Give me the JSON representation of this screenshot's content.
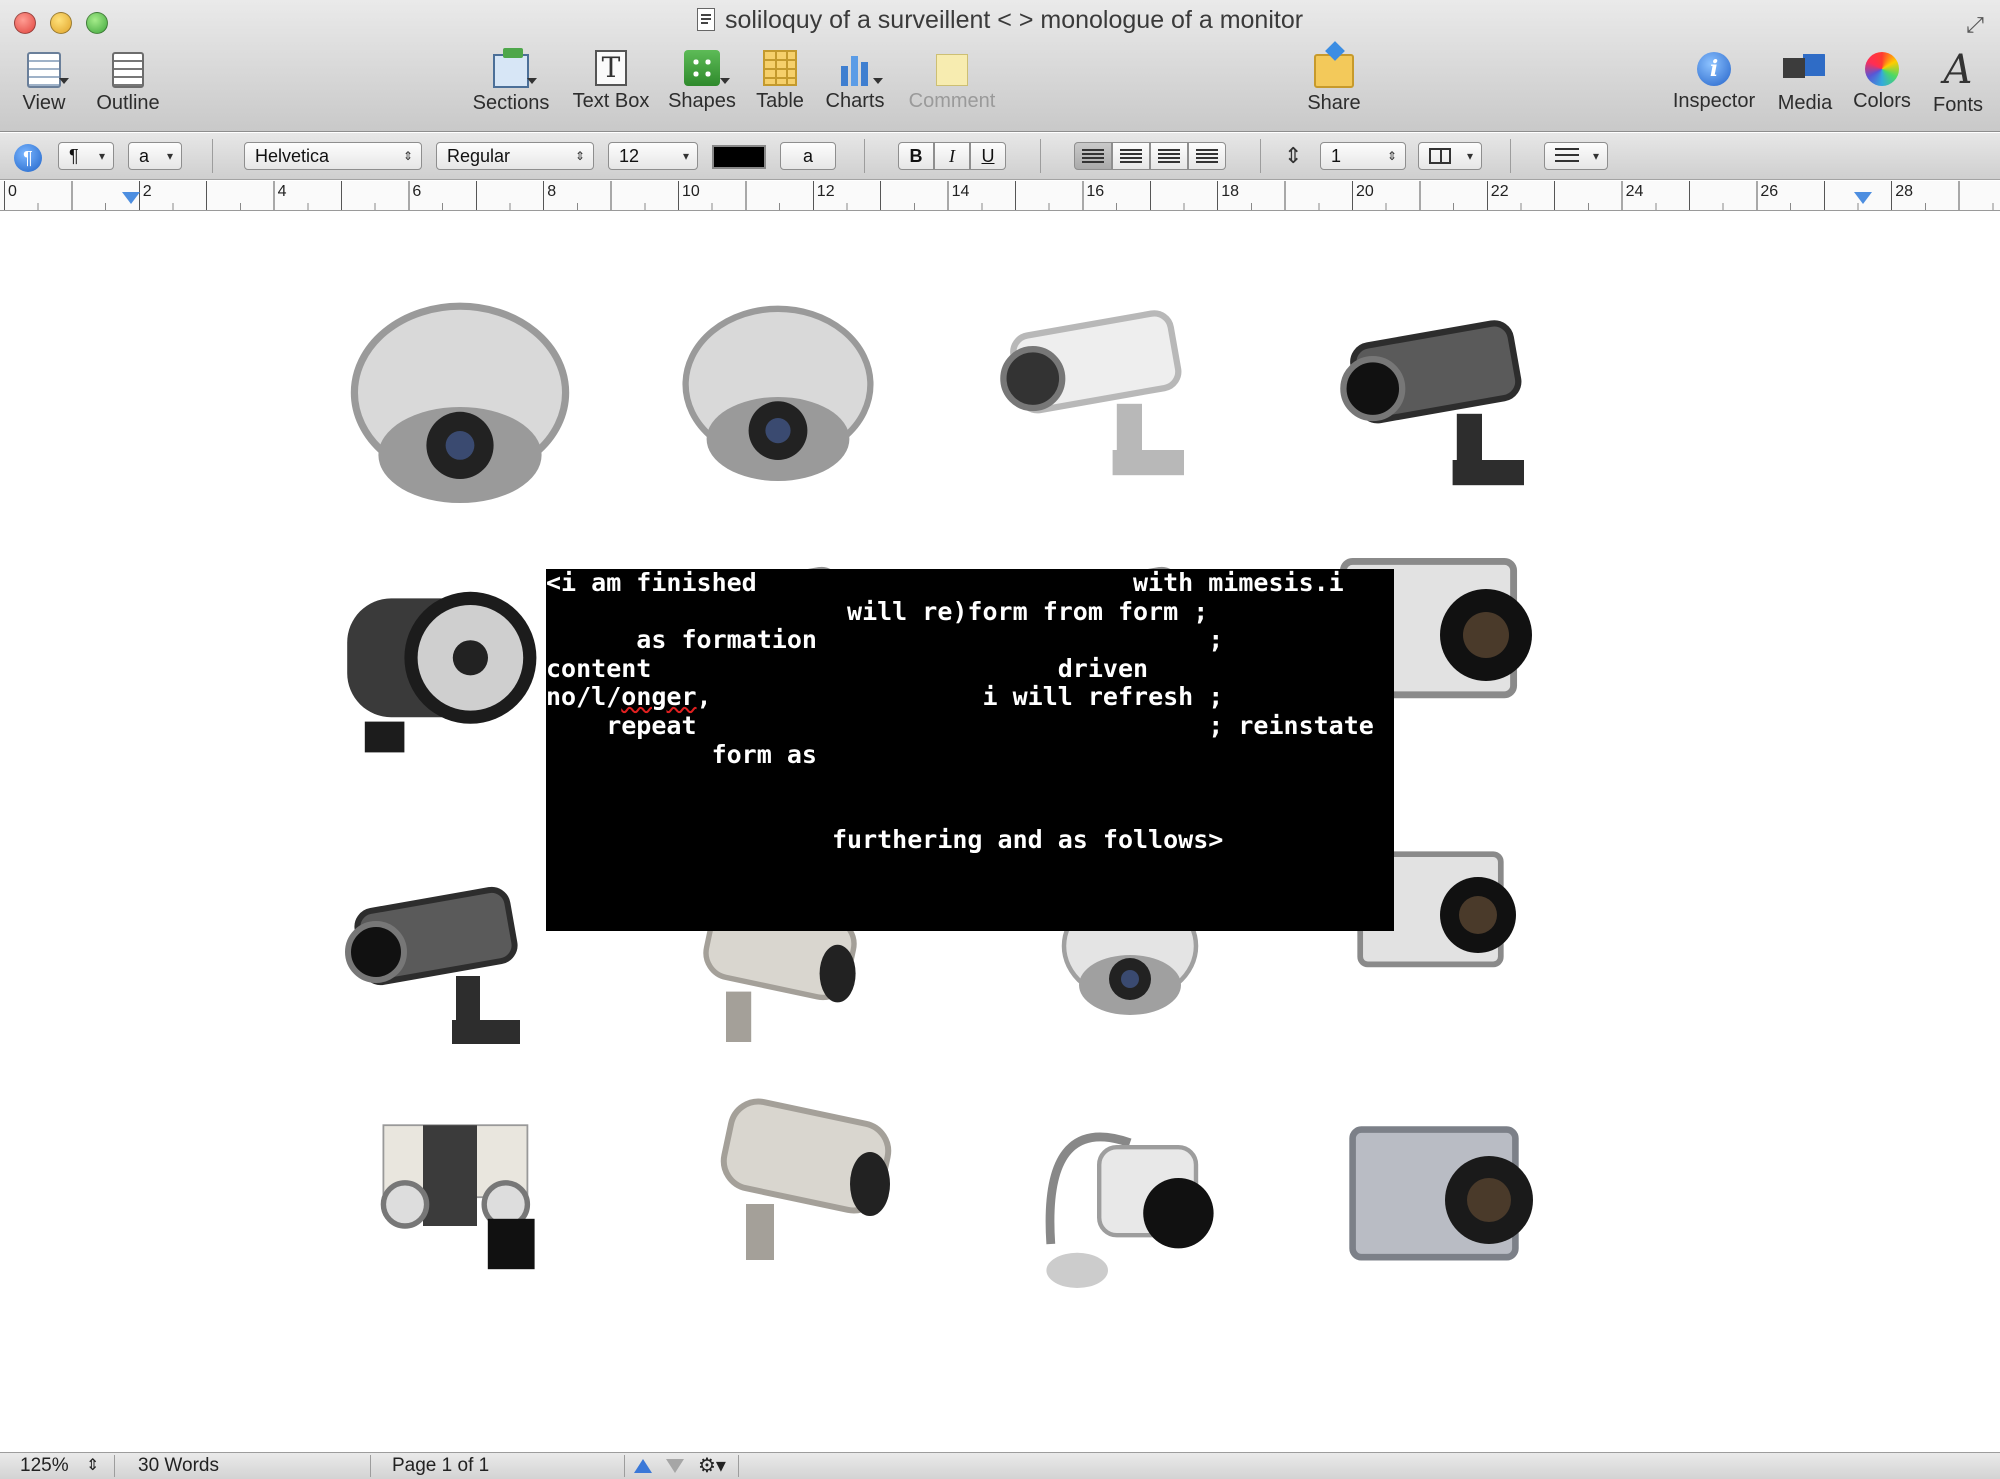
{
  "window": {
    "title": "soliloquy of a surveillent < > monologue of a monitor",
    "fullscreen_glyph": "⤢"
  },
  "toolbar": {
    "left": [
      {
        "label": "View",
        "icon": "view-icon"
      },
      {
        "label": "Outline",
        "icon": "outline-icon"
      }
    ],
    "center": [
      {
        "label": "Sections",
        "icon": "sections-icon"
      },
      {
        "label": "Text Box",
        "icon": "text-box-icon",
        "glyph": "T"
      },
      {
        "label": "Shapes",
        "icon": "shapes-icon"
      },
      {
        "label": "Table",
        "icon": "table-icon"
      },
      {
        "label": "Charts",
        "icon": "charts-icon"
      },
      {
        "label": "Comment",
        "icon": "comment-icon",
        "disabled": true
      }
    ],
    "share": {
      "label": "Share",
      "icon": "share-icon"
    },
    "right": [
      {
        "label": "Inspector",
        "icon": "inspector-icon",
        "glyph": "i"
      },
      {
        "label": "Media",
        "icon": "media-icon"
      },
      {
        "label": "Colors",
        "icon": "colors-icon"
      },
      {
        "label": "Fonts",
        "icon": "fonts-icon",
        "glyph": "A"
      }
    ]
  },
  "format_bar": {
    "paragraph_style": "¶",
    "character_style": "a",
    "font_family": "Helvetica",
    "typeface": "Regular",
    "font_size": "12",
    "text_color": "#000000",
    "highlight_glyph": "a",
    "bold": "B",
    "italic": "I",
    "underline": "U",
    "line_spacing": "1",
    "arrow": "▾",
    "stepper": "⇕"
  },
  "ruler": {
    "numbers": [
      "0",
      "2",
      "4",
      "6",
      "8",
      "10",
      "12",
      "14",
      "16",
      "18",
      "20",
      "22",
      "24",
      "26",
      "28"
    ]
  },
  "document": {
    "camera_images": [
      "dome-camera",
      "dome-camera",
      "box-camera-wall-mount",
      "bullet-camera",
      "ir-camera",
      "partial-camera",
      "partial-camera",
      "box-camera",
      "bullet-camera",
      "housing-camera",
      "speed-dome-camera",
      "box-camera",
      "dual-lens-camera",
      "housing-camera",
      "bracket-camera",
      "zoom-box-camera"
    ],
    "poem_lines": [
      "<i am finished                         with mimesis.i",
      "                    will re)form from form ;",
      "      as formation                          ;",
      "content                           driven",
      "no/l/onger,                  i will refresh ;",
      "    repeat                                  ; reinstate",
      "           form as",
      "",
      "",
      "                   furthering and as follows>"
    ],
    "misspelled_word": "onger"
  },
  "status_bar": {
    "zoom": "125%",
    "word_count": "30 Words",
    "page_indicator": "Page 1 of 1",
    "zoom_stepper": "⇕",
    "gear_glyph": "⚙▾"
  },
  "colors": {
    "monitor_background": "#000000",
    "monitor_text": "#ffffff",
    "accent_blue": "#3a78d8",
    "spellcheck_red": "#e02020"
  }
}
